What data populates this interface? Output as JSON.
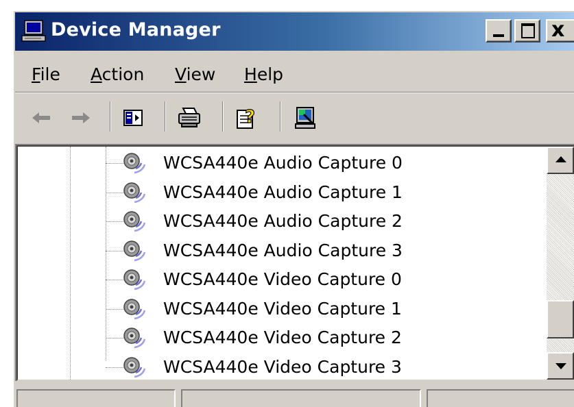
{
  "window": {
    "title": "Device Manager",
    "controls": {
      "minimize": "minimize",
      "maximize": "maximize",
      "close": "x"
    }
  },
  "menu": {
    "file": {
      "mnemonic": "F",
      "rest": "ile"
    },
    "action": {
      "mnemonic": "A",
      "rest": "ction"
    },
    "view": {
      "mnemonic": "V",
      "rest": "iew"
    },
    "help": {
      "mnemonic": "H",
      "rest": "elp"
    }
  },
  "toolbar": {
    "icons": [
      "back-arrow-icon",
      "forward-arrow-icon",
      "show-hide-console-tree-icon",
      "print-icon",
      "help-icon",
      "scan-hardware-icon"
    ]
  },
  "tree": {
    "items": [
      {
        "name": "WCSA440e",
        "label": "Audio Capture 0"
      },
      {
        "name": "WCSA440e",
        "label": "Audio Capture 1"
      },
      {
        "name": "WCSA440e",
        "label": "Audio Capture 2"
      },
      {
        "name": "WCSA440e",
        "label": "Audio Capture 3"
      },
      {
        "name": "WCSA440e",
        "label": "Video Capture 0"
      },
      {
        "name": "WCSA440e",
        "label": "Video Capture 1"
      },
      {
        "name": "WCSA440e",
        "label": "Video Capture 2"
      },
      {
        "name": "WCSA440e",
        "label": "Video Capture 3"
      }
    ]
  },
  "colors": {
    "titlebar_start": "#0a246a",
    "titlebar_end": "#a6caf0",
    "chrome": "#d4d0c8"
  }
}
